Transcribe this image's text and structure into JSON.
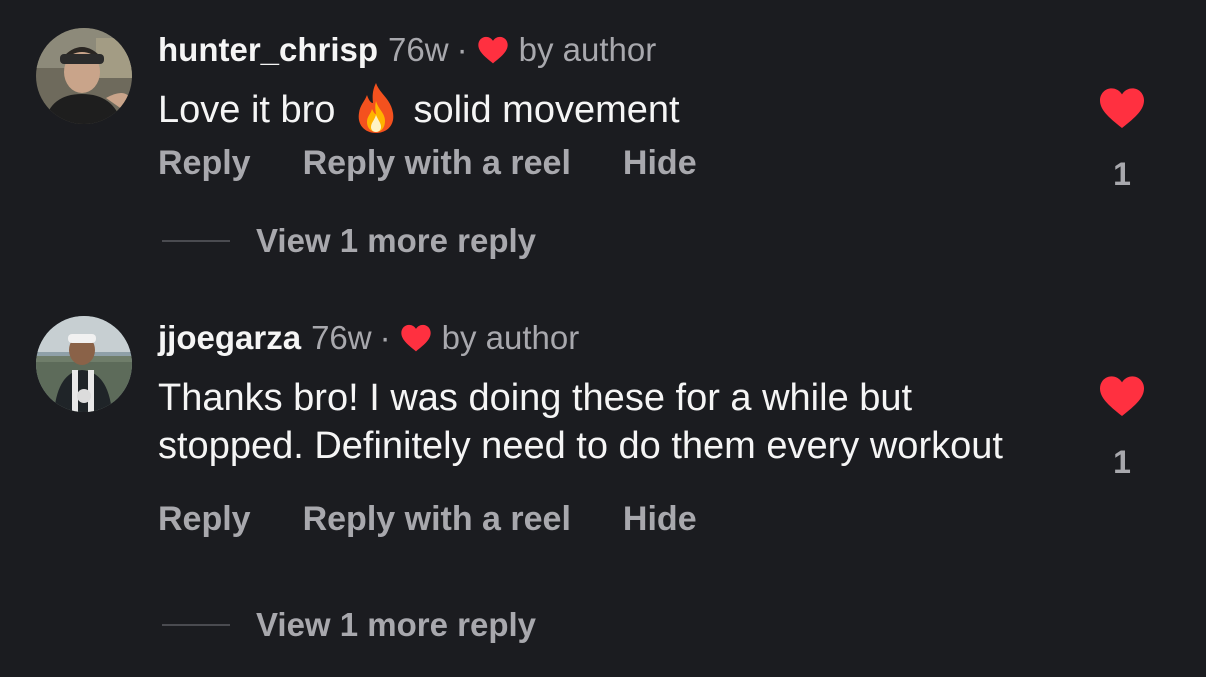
{
  "colors": {
    "background": "#1b1c20",
    "primary_text": "#f5f5f5",
    "secondary_text": "#a8a8ad",
    "heart": "#ff3040"
  },
  "comments": [
    {
      "username": "hunter_chrisp",
      "time": "76w",
      "separator": "·",
      "by_author": "by author",
      "text_before_emoji": "Love it bro",
      "emoji": "fire-icon",
      "text_after_emoji": "solid movement",
      "actions": {
        "reply": "Reply",
        "reply_reel": "Reply with a reel",
        "hide": "Hide"
      },
      "view_more": "View 1 more reply",
      "like_count": "1",
      "liked": true,
      "avatar_icon": "avatar-photo"
    },
    {
      "username": "jjoegarza",
      "time": "76w",
      "separator": "·",
      "by_author": "by author",
      "text": "Thanks bro! I was doing these for a while but stopped. Definitely need to do them every workout",
      "actions": {
        "reply": "Reply",
        "reply_reel": "Reply with a reel",
        "hide": "Hide"
      },
      "view_more": "View 1 more reply",
      "like_count": "1",
      "liked": true,
      "avatar_icon": "avatar-photo"
    }
  ]
}
